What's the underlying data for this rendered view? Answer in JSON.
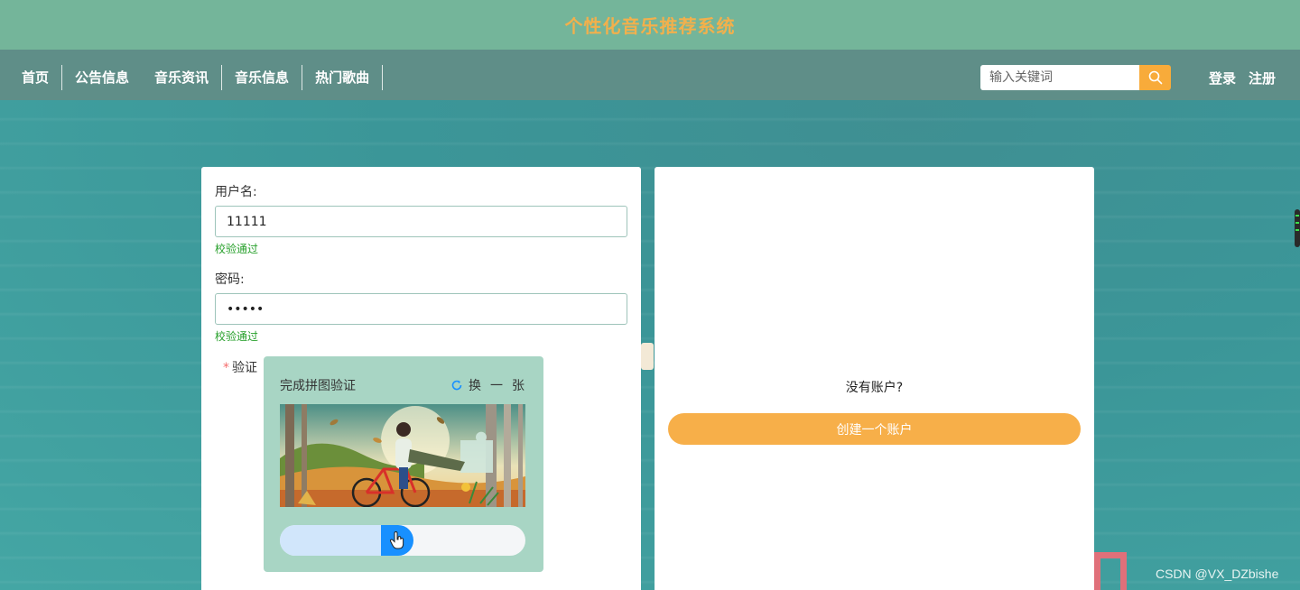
{
  "header": {
    "site_title": "个性化音乐推荐系统"
  },
  "nav": {
    "items": [
      {
        "label": "首页"
      },
      {
        "label": "公告信息"
      },
      {
        "label": "音乐资讯"
      },
      {
        "label": "音乐信息"
      },
      {
        "label": "热门歌曲"
      }
    ]
  },
  "search": {
    "placeholder": "输入关键词",
    "icon": "search-icon"
  },
  "auth": {
    "login": "登录",
    "register": "注册"
  },
  "login_form": {
    "username_label": "用户名:",
    "username_value": "11111",
    "username_valid": "校验通过",
    "password_label": "密码:",
    "password_value": "•••••",
    "password_valid": "校验通过",
    "captcha_required_mark": "*",
    "captcha_label": "验证"
  },
  "captcha": {
    "title": "完成拼图验证",
    "refresh_label": "换一张",
    "refresh_icon": "refresh-icon",
    "slider_progress": 0.5
  },
  "register_panel": {
    "prompt": "没有账户?",
    "create_button": "创建一个账户"
  },
  "watermark": "CSDN @VX_DZbishe",
  "colors": {
    "header_bg": "#74b59a",
    "title_color": "#f2b04c",
    "nav_bg": "#5f8e88",
    "accent": "#f8ab3a",
    "slider_handle": "#1890ff",
    "valid_text": "#27a02b"
  }
}
